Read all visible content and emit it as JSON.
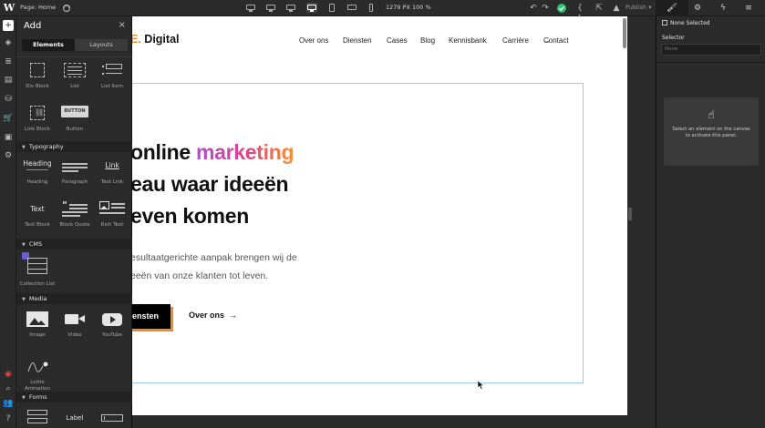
{
  "topbar": {
    "logo": "W",
    "page_selector": "Page: Home",
    "canvas_width": "1279 PX",
    "zoom": "100 %",
    "publish_label": "Publish"
  },
  "add_panel": {
    "title": "Add",
    "close": "×",
    "tabs": [
      {
        "label": "Elements",
        "active": true
      },
      {
        "label": "Layouts",
        "active": false
      }
    ],
    "layout_elements": [
      {
        "label": "Div Block"
      },
      {
        "label": "List"
      },
      {
        "label": "List Item"
      },
      {
        "label": "Link Block"
      },
      {
        "label": "Button",
        "thumb_text": "BUTTON"
      }
    ],
    "sections": {
      "typography": "Typography",
      "cms": "CMS",
      "media": "Media",
      "forms": "Forms"
    },
    "typography_elements": [
      {
        "label": "Heading",
        "thumb_text": "Heading"
      },
      {
        "label": "Paragraph"
      },
      {
        "label": "Text Link",
        "thumb_text": "Link"
      },
      {
        "label": "Text Block",
        "thumb_text": "Text"
      },
      {
        "label": "Block Quote"
      },
      {
        "label": "Rich Text"
      }
    ],
    "cms_elements": [
      {
        "label": "Collection List"
      }
    ],
    "media_elements": [
      {
        "label": "Image"
      },
      {
        "label": "Video"
      },
      {
        "label": "YouTube"
      },
      {
        "label_line1": "Lottie",
        "label_line2": "Animation"
      }
    ],
    "forms_elements": [
      {
        "label": ""
      },
      {
        "label": "",
        "thumb_text": "Label"
      },
      {
        "label": ""
      }
    ]
  },
  "site": {
    "brand_suffix": "E.",
    "brand_name": "Digital",
    "nav": [
      "Over ons",
      "Diensten",
      "Cases",
      "Blog",
      "Kennisbank",
      "Carrière",
      "Contact"
    ],
    "heading_line1_a": "online ",
    "heading_line1_b": "marketing",
    "heading_line2": "eau waar ideeën",
    "heading_line3": "even komen",
    "paragraph_line1": "esultaatgerichte aanpak brengen wij de",
    "paragraph_line2": "eeën van onze klanten tot leven.",
    "primary_button": "ensten",
    "secondary_button": "Over ons"
  },
  "right_panel": {
    "none_selected": "None Selected",
    "selector_label": "Selector",
    "selector_placeholder": "None",
    "hint_text": "Select an element on the canvas to activate this panel."
  },
  "colors": {
    "accent_orange": "#f28c28",
    "gradient_start": "#b24ad8",
    "gradient_end": "#f39431",
    "selection_blue": "#9ccbf0"
  }
}
